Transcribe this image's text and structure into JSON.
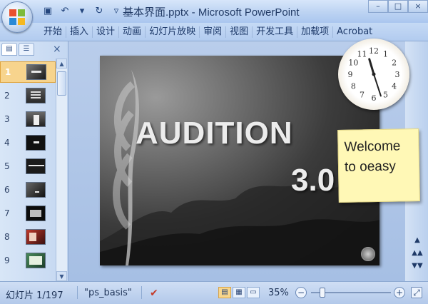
{
  "window": {
    "title": "基本界面.pptx - Microsoft PowerPoint",
    "controls": [
      "–",
      "□",
      "×"
    ]
  },
  "quick_access": [
    {
      "icon": "save-icon",
      "glyph": "▣"
    },
    {
      "icon": "undo-icon",
      "glyph": "↶"
    },
    {
      "icon": "undo-dropdown-icon",
      "glyph": "▾"
    },
    {
      "icon": "redo-icon",
      "glyph": "↻"
    },
    {
      "icon": "customize-dropdown-icon",
      "glyph": "▿"
    }
  ],
  "ribbon": {
    "tabs": [
      "开始",
      "插入",
      "设计",
      "动画",
      "幻灯片放映",
      "审阅",
      "视图",
      "开发工具",
      "加载项",
      "Acrobat"
    ]
  },
  "pane": {
    "tabs": [
      "▤",
      "☰"
    ],
    "close": "×",
    "slides": [
      {
        "num": "1",
        "active": true
      },
      {
        "num": "2",
        "active": false
      },
      {
        "num": "3",
        "active": false
      },
      {
        "num": "4",
        "active": false
      },
      {
        "num": "5",
        "active": false
      },
      {
        "num": "6",
        "active": false
      },
      {
        "num": "7",
        "active": false
      },
      {
        "num": "8",
        "active": false
      },
      {
        "num": "9",
        "active": false
      }
    ]
  },
  "slide": {
    "title": "AUDITION",
    "version": "3.0"
  },
  "gadgets": {
    "clock": {
      "hour": 11,
      "minute": 27,
      "numbers": [
        "12",
        "1",
        "2",
        "3",
        "4",
        "5",
        "6",
        "7",
        "8",
        "9",
        "10",
        "11"
      ]
    },
    "note": {
      "lines": [
        "Welcome",
        "to oeasy"
      ]
    }
  },
  "status": {
    "slide_indicator": "幻灯片 1/197",
    "theme": "\"ps_basis\"",
    "zoom": "35%",
    "zoom_fraction": 0.35
  },
  "scroll": {
    "up": "▲",
    "down": "▼",
    "prev": "▲▲",
    "next": "▼▼"
  },
  "colors": {
    "accent": "#f7d48d",
    "ribbon": "#b2cbef"
  }
}
